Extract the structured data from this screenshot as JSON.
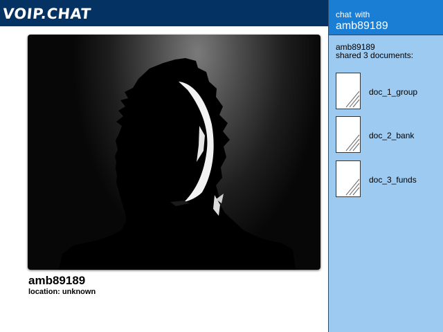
{
  "app": {
    "logo": "VOIP.CHAT"
  },
  "video": {
    "caller_name": "amb89189",
    "caller_location": "location: unknown"
  },
  "panel": {
    "chat_with_label": "chat with",
    "chat_with_user": "amb89189",
    "shared_user": "amb89189",
    "shared_text": "shared 3 documents:",
    "documents": [
      {
        "name": "doc_1_group"
      },
      {
        "name": "doc_2_bank"
      },
      {
        "name": "doc_3_funds"
      }
    ]
  },
  "colors": {
    "topbar": "#043262",
    "panel_header": "#1a7fd4",
    "panel_background": "#9dcaf0"
  }
}
